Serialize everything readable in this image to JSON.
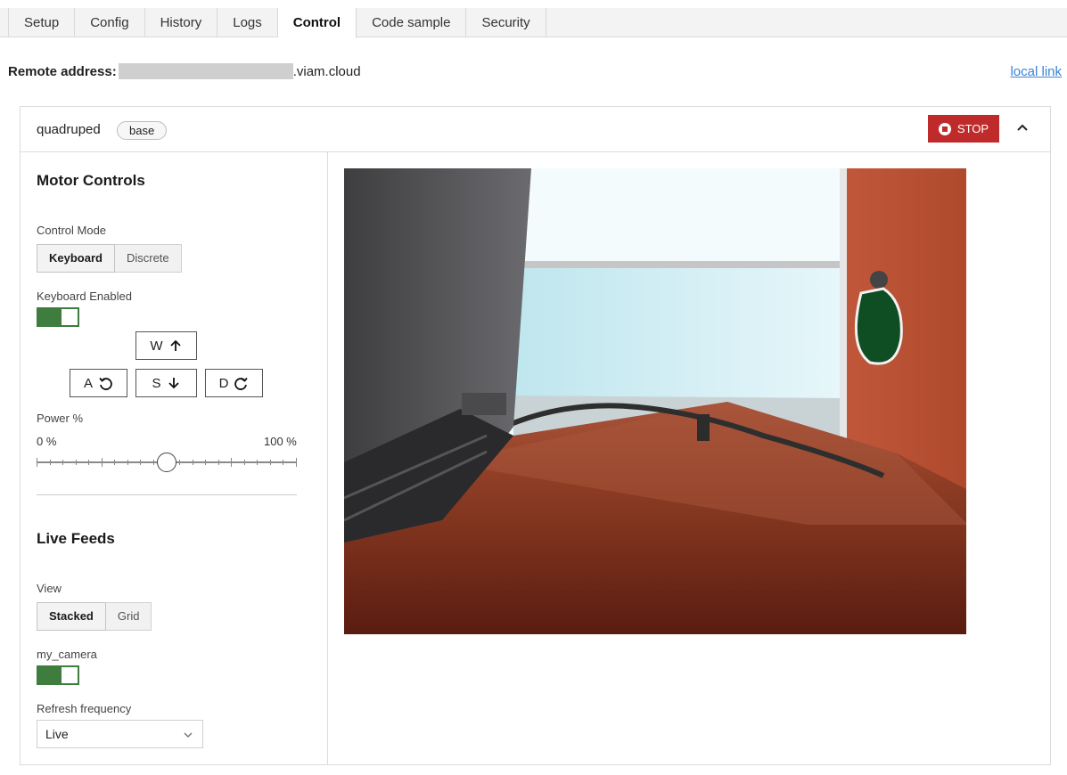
{
  "tabs": [
    {
      "label": "Setup"
    },
    {
      "label": "Config"
    },
    {
      "label": "History"
    },
    {
      "label": "Logs"
    },
    {
      "label": "Control",
      "active": true
    },
    {
      "label": "Code sample"
    },
    {
      "label": "Security"
    }
  ],
  "remote": {
    "label": "Remote address:",
    "suffix": ".viam.cloud",
    "local_link": "local link"
  },
  "component": {
    "name": "quadruped",
    "type_badge": "base",
    "stop_label": "STOP",
    "stop_color": "#bf2b2b"
  },
  "motor_controls": {
    "title": "Motor Controls",
    "control_mode_label": "Control Mode",
    "modes": [
      "Keyboard",
      "Discrete"
    ],
    "selected_mode": "Keyboard",
    "keyboard_enabled_label": "Keyboard Enabled",
    "keyboard_enabled": true,
    "keys": {
      "w": "W",
      "a": "A",
      "s": "S",
      "d": "D"
    },
    "power_label": "Power %",
    "power_min_label": "0 %",
    "power_max_label": "100 %",
    "power_value_percent": 50
  },
  "live_feeds": {
    "title": "Live Feeds",
    "view_label": "View",
    "views": [
      "Stacked",
      "Grid"
    ],
    "selected_view": "Stacked",
    "camera_name": "my_camera",
    "camera_enabled": true,
    "refresh_label": "Refresh frequency",
    "refresh_value": "Live"
  },
  "colors": {
    "toggle_on": "#3e7d3e",
    "link": "#3b82d6"
  }
}
